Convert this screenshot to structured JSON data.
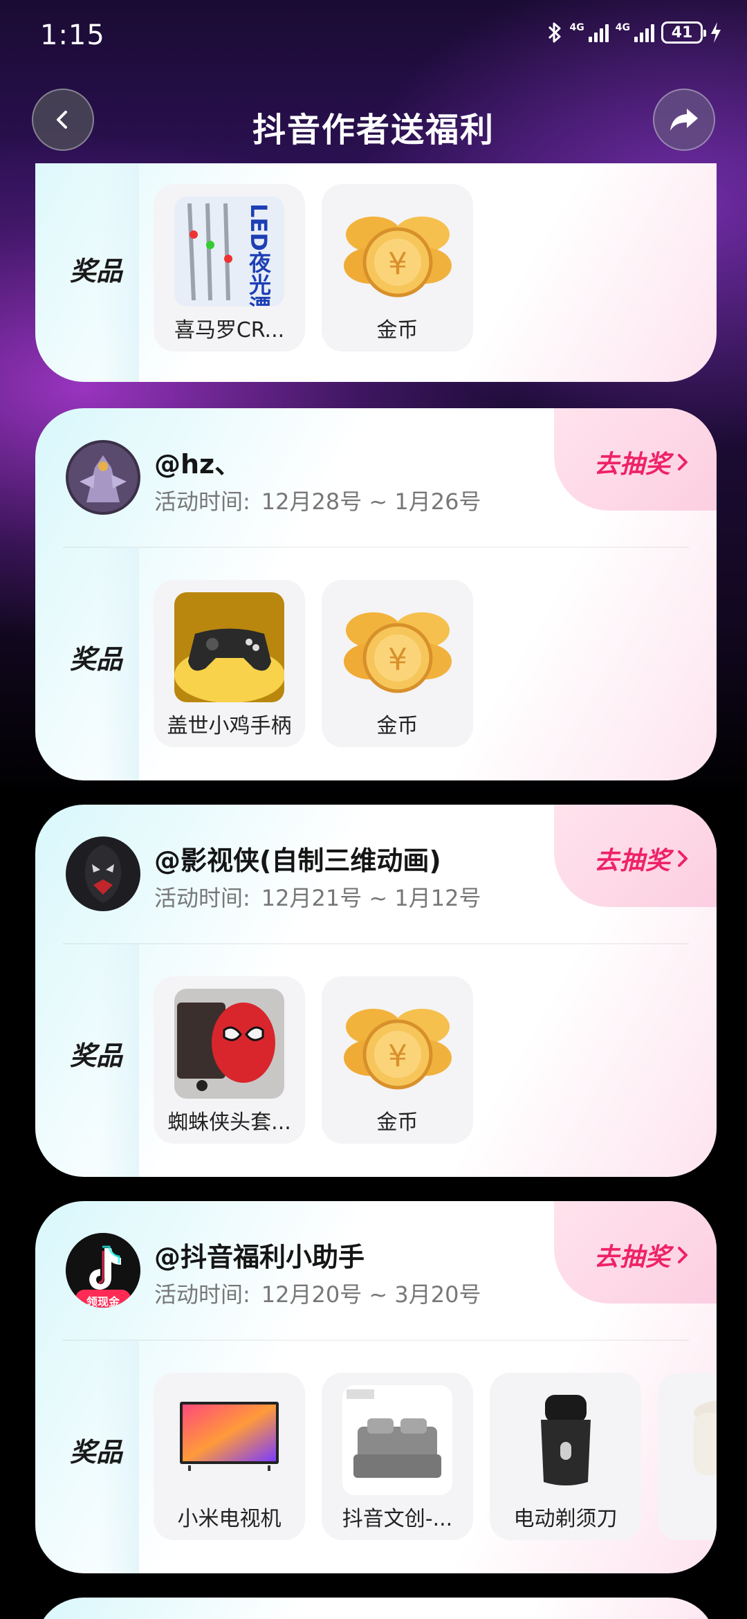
{
  "status_bar": {
    "time": "1:15",
    "network_1": "4G",
    "network_2": "4G",
    "battery": "41"
  },
  "header": {
    "title": "抖音作者送福利"
  },
  "prize_label": "奖品",
  "time_label": "活动时间:",
  "draw_label": "去抽奖",
  "top_card": {
    "prizes": [
      {
        "name": "喜马罗CR...",
        "image": "led-float-product",
        "image_text": "LED夜光漂"
      },
      {
        "name": "金币",
        "image": "gold-coins"
      }
    ]
  },
  "cards": [
    {
      "author": "@hz、",
      "dates": "12月28号 ~ 1月26号",
      "avatar": "mech-robot",
      "prizes": [
        {
          "name": "盖世小鸡手柄",
          "image": "game-controller"
        },
        {
          "name": "金币",
          "image": "gold-coins"
        }
      ]
    },
    {
      "author": "@影视侠(自制三维动画)",
      "dates": "12月21号 ~ 1月12号",
      "avatar": "dark-hero",
      "prizes": [
        {
          "name": "蜘蛛侠头套...",
          "image": "spiderman-mask"
        },
        {
          "name": "金币",
          "image": "gold-coins"
        }
      ]
    },
    {
      "author": "@抖音福利小助手",
      "dates": "12月20号 ~ 3月20号",
      "avatar": "douyin-logo",
      "avatar_badge": "领现金",
      "prizes": [
        {
          "name": "小米电视机",
          "image": "television"
        },
        {
          "name": "抖音文创-...",
          "image": "bedding-set"
        },
        {
          "name": "电动剃须刀",
          "image": "electric-shaver"
        },
        {
          "name": "",
          "image": "rice-cooker"
        }
      ]
    }
  ],
  "colors": {
    "accent": "#ee2266",
    "card_start": "#d8f7fb",
    "card_end": "#fde3ee"
  }
}
